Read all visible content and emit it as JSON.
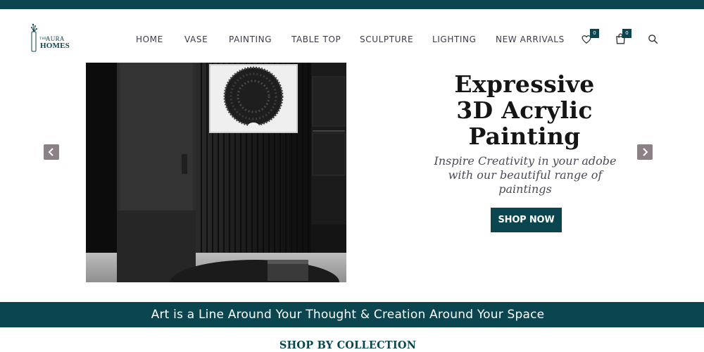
{
  "brand": {
    "logo_small": "THE",
    "logo_top": "AURA",
    "logo_bottom": "HOMES",
    "color": "#0b4650"
  },
  "nav": {
    "items": [
      {
        "label": "HOME"
      },
      {
        "label": "VASE"
      },
      {
        "label": "PAINTING"
      },
      {
        "label": "TABLE TOP"
      },
      {
        "label": "SCULPTURE"
      },
      {
        "label": "LIGHTING"
      },
      {
        "label": "NEW ARRIVALS"
      }
    ]
  },
  "header_icons": {
    "wishlist": {
      "icon": "heart-icon",
      "count": "0"
    },
    "cart": {
      "icon": "shopping-bag-icon",
      "count": "0"
    },
    "search": {
      "icon": "search-icon"
    }
  },
  "hero": {
    "headline": [
      "Expressive",
      "3D Acrylic",
      "Painting"
    ],
    "tagline": [
      "Inspire Creativity in your adobe",
      "with our beautiful range of",
      "paintings"
    ],
    "cta_label": "SHOP NOW",
    "prev_icon": "chevron-left-icon",
    "next_icon": "chevron-right-icon",
    "arrow_color": "#8c8186"
  },
  "banner": {
    "text": "Art is a Line Around Your Thought & Creation Around Your Space"
  },
  "collection": {
    "title": "SHOP BY COLLECTION"
  }
}
